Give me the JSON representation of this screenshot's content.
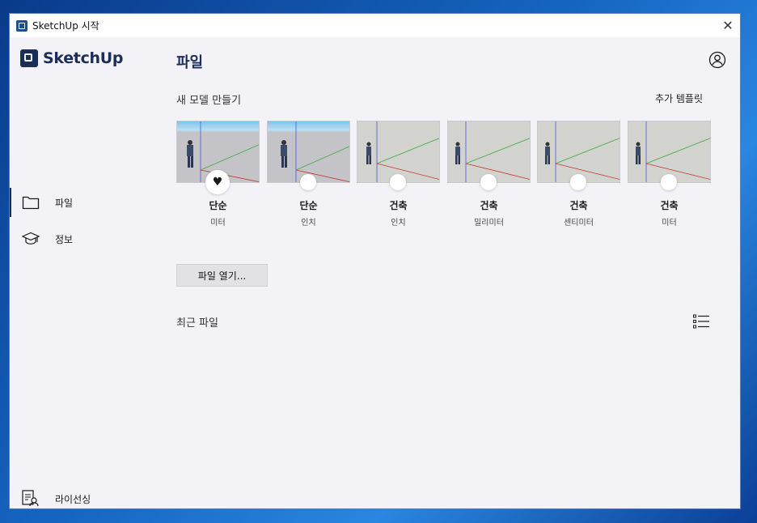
{
  "window": {
    "title": "SketchUp 시작",
    "close_glyph": "✕"
  },
  "brand": {
    "name": "SketchUp"
  },
  "sidebar": {
    "items": [
      {
        "label": "파일",
        "icon": "folder-icon",
        "active": true
      },
      {
        "label": "정보",
        "icon": "graduation-cap-icon",
        "active": false
      }
    ],
    "license": {
      "label": "라이선싱",
      "icon": "license-icon"
    }
  },
  "main": {
    "title": "파일",
    "new_model": {
      "heading": "새 모델 만들기",
      "more_templates": "추가 템플릿"
    },
    "templates": [
      {
        "name": "단순",
        "unit": "미터",
        "favorite": true
      },
      {
        "name": "단순",
        "unit": "인치",
        "favorite": false
      },
      {
        "name": "건축",
        "unit": "인치",
        "favorite": false
      },
      {
        "name": "건축",
        "unit": "밀리미터",
        "favorite": false
      },
      {
        "name": "건축",
        "unit": "센티미터",
        "favorite": false
      },
      {
        "name": "건축",
        "unit": "미터",
        "favorite": false
      }
    ],
    "open_file_button": "파일 열기...",
    "recent": {
      "heading": "최근 파일"
    }
  },
  "colors": {
    "brand": "#1b2d59",
    "background": "#f3f3f7",
    "axis_red": "#c0392b",
    "axis_green": "#3daa3d",
    "axis_blue": "#4a5bd0"
  }
}
